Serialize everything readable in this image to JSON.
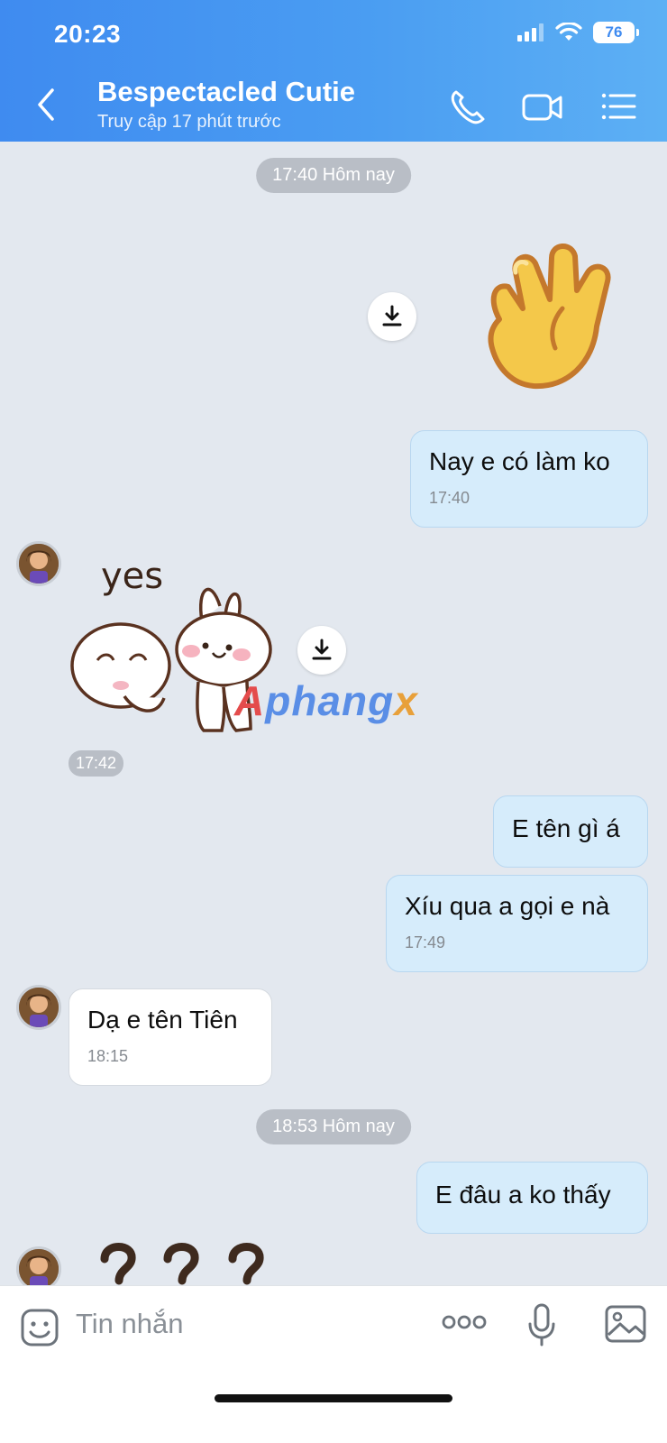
{
  "status_bar": {
    "time": "20:23",
    "battery": "76"
  },
  "header": {
    "contact_name": "Bespectacled Cutie",
    "contact_status": "Truy cập 17 phút trước",
    "colors": {
      "gradient_start": "#3f8bf0",
      "gradient_end": "#5db0f4"
    }
  },
  "conversation": {
    "dividers": [
      "17:40 Hôm nay",
      "18:53 Hôm nay"
    ],
    "messages": [
      {
        "kind": "sticker",
        "direction": "out",
        "sticker": "waving-hand"
      },
      {
        "kind": "text",
        "direction": "out",
        "text": "Nay e có làm ko",
        "time": "17:40"
      },
      {
        "kind": "sticker",
        "direction": "in",
        "sticker": "bunny-yes",
        "sticker_text": "yes",
        "time": "17:42"
      },
      {
        "kind": "text",
        "direction": "out",
        "text": "E tên gì á"
      },
      {
        "kind": "text",
        "direction": "out",
        "text": "Xíu qua a gọi e nà",
        "time": "17:49"
      },
      {
        "kind": "text",
        "direction": "in",
        "text": "Dạ e tên Tiên",
        "time": "18:15"
      },
      {
        "kind": "text",
        "direction": "out",
        "text": "E đâu a ko thấy"
      },
      {
        "kind": "sticker",
        "direction": "in",
        "sticker": "question-marks"
      }
    ]
  },
  "watermark": {
    "part1": "A",
    "part2": "phang",
    "part3": "x"
  },
  "input_bar": {
    "placeholder": "Tin nhắn"
  }
}
